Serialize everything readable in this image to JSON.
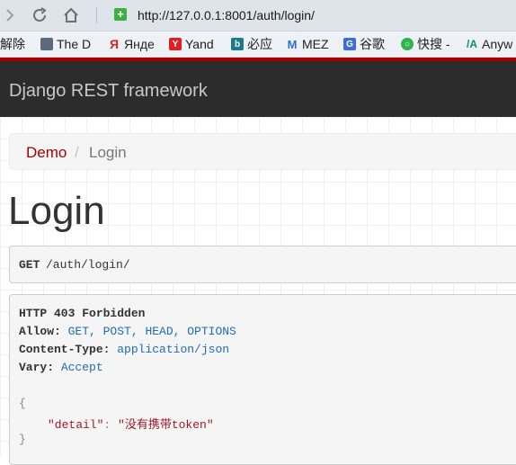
{
  "browser": {
    "url": "http://127.0.0.1:8001/auth/login/",
    "bookmarks": [
      "解除",
      "The D",
      "Янде",
      "Yand",
      "必应",
      "MEZ",
      "谷歌",
      "快搜 -",
      "Anyw"
    ]
  },
  "app": {
    "brand": "Django REST framework"
  },
  "breadcrumb": {
    "items": [
      "Demo",
      "Login"
    ],
    "separator": "/"
  },
  "page": {
    "title": "Login"
  },
  "request": {
    "method": "GET",
    "path": "/auth/login/"
  },
  "response": {
    "status": "HTTP 403 Forbidden",
    "headers": [
      {
        "name": "Allow:",
        "value": "GET, POST, HEAD, OPTIONS"
      },
      {
        "name": "Content-Type:",
        "value": "application/json"
      },
      {
        "name": "Vary:",
        "value": "Accept"
      }
    ],
    "body": {
      "open": "{",
      "key": "\"detail\"",
      "colon": ": ",
      "value": "\"没有携带token\"",
      "close": "}"
    }
  },
  "colors": {
    "brand_red": "#a30000",
    "navbar": "#2c2c2c",
    "link_blue": "#1e6bb8"
  }
}
